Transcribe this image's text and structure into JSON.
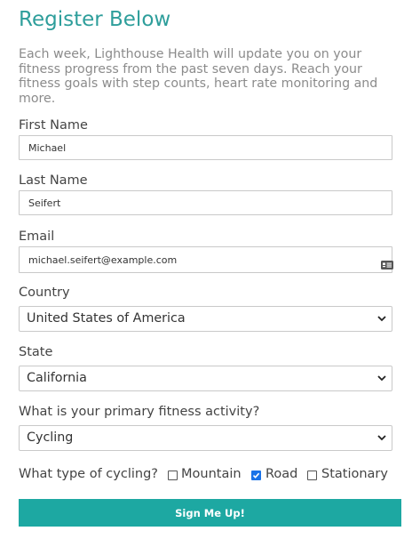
{
  "form": {
    "title": "Register Below",
    "intro": "Each week, Lighthouse Health will update you on your fitness progress from the past seven days. Reach your fitness goals with step counts, heart rate monitoring and more.",
    "first_name": {
      "label": "First Name",
      "value": "Michael"
    },
    "last_name": {
      "label": "Last Name",
      "value": "Seifert"
    },
    "email": {
      "label": "Email",
      "value": "michael.seifert@example.com",
      "icon": "contact-card-icon"
    },
    "country": {
      "label": "Country",
      "selected": "United States of America"
    },
    "state": {
      "label": "State",
      "selected": "California"
    },
    "activity": {
      "label": "What is your primary fitness activity?",
      "selected": "Cycling"
    },
    "cycling_type": {
      "label": "What type of cycling?",
      "options": [
        {
          "label": "Mountain",
          "checked": false
        },
        {
          "label": "Road",
          "checked": true
        },
        {
          "label": "Stationary",
          "checked": false
        }
      ]
    },
    "submit_label": "Sign Me Up!"
  },
  "colors": {
    "accent": "#1da8a2",
    "heading": "#2e9e9b",
    "checkbox_checked": "#1a73e8"
  }
}
